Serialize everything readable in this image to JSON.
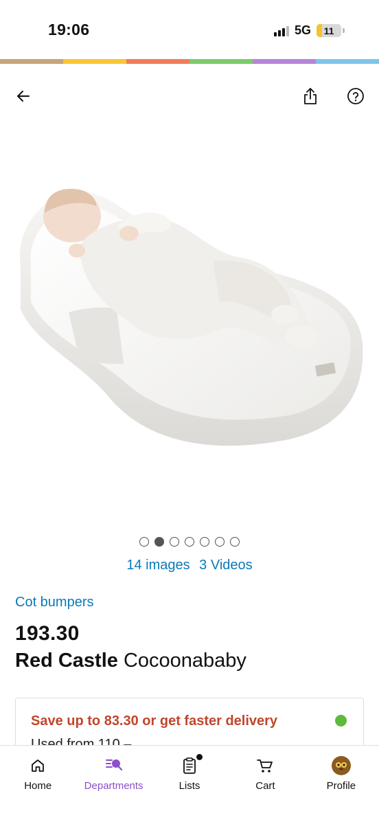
{
  "status_bar": {
    "time": "19:06",
    "network": "5G",
    "battery_level": "11",
    "battery_fraction": 0.11
  },
  "color_strip": [
    "#c9a47a",
    "#f9c634",
    "#f07d5a",
    "#7ccc6a",
    "#b784d8",
    "#7fc4ec"
  ],
  "top_nav": {
    "back_icon": "arrow-left-icon",
    "share_icon": "share-icon",
    "help_icon": "question-circle-icon"
  },
  "gallery": {
    "image_description_icon": "product-photo",
    "dot_count": 7,
    "active_index": 1,
    "images_label": "14 images",
    "videos_label": "3 Videos"
  },
  "product": {
    "category": "Cot bumpers",
    "price": "193.30",
    "brand": "Red Castle",
    "name": "Cocoonababy"
  },
  "offer_card": {
    "save_text": "Save up to 83.30 or get faster delivery",
    "used_text": "Used from 110 –",
    "status_color": "#5dba3b"
  },
  "bottom_nav": {
    "items": [
      {
        "label": "Home",
        "icon": "home-icon"
      },
      {
        "label": "Departments",
        "icon": "departments-icon",
        "active": true
      },
      {
        "label": "Lists",
        "icon": "list-icon"
      },
      {
        "label": "Cart",
        "icon": "cart-icon"
      },
      {
        "label": "Profile",
        "icon": "profile-avatar-icon"
      }
    ]
  },
  "colors": {
    "link": "#0a79b8",
    "save_red": "#c0462b",
    "active_purple": "#8b4fc9"
  }
}
